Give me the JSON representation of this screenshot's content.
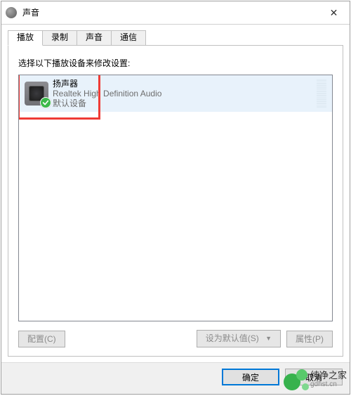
{
  "window": {
    "title": "声音"
  },
  "tabs": [
    {
      "id": "playback",
      "label": "播放",
      "active": true
    },
    {
      "id": "record",
      "label": "录制"
    },
    {
      "id": "sound",
      "label": "声音"
    },
    {
      "id": "comm",
      "label": "通信"
    }
  ],
  "panel": {
    "instruction": "选择以下播放设备来修改设置:"
  },
  "devices": [
    {
      "name": "扬声器",
      "driver": "Realtek High Definition Audio",
      "status": "默认设备",
      "icon": "speaker-icon",
      "default": true,
      "selected": true
    }
  ],
  "panel_buttons": {
    "configure": "配置(C)",
    "set_default": "设为默认值(S)",
    "properties": "属性(P)"
  },
  "dialog_buttons": {
    "ok": "确定",
    "cancel": "取消"
  },
  "brand": {
    "name": "纯净之家",
    "url": "gdhst.cn"
  }
}
